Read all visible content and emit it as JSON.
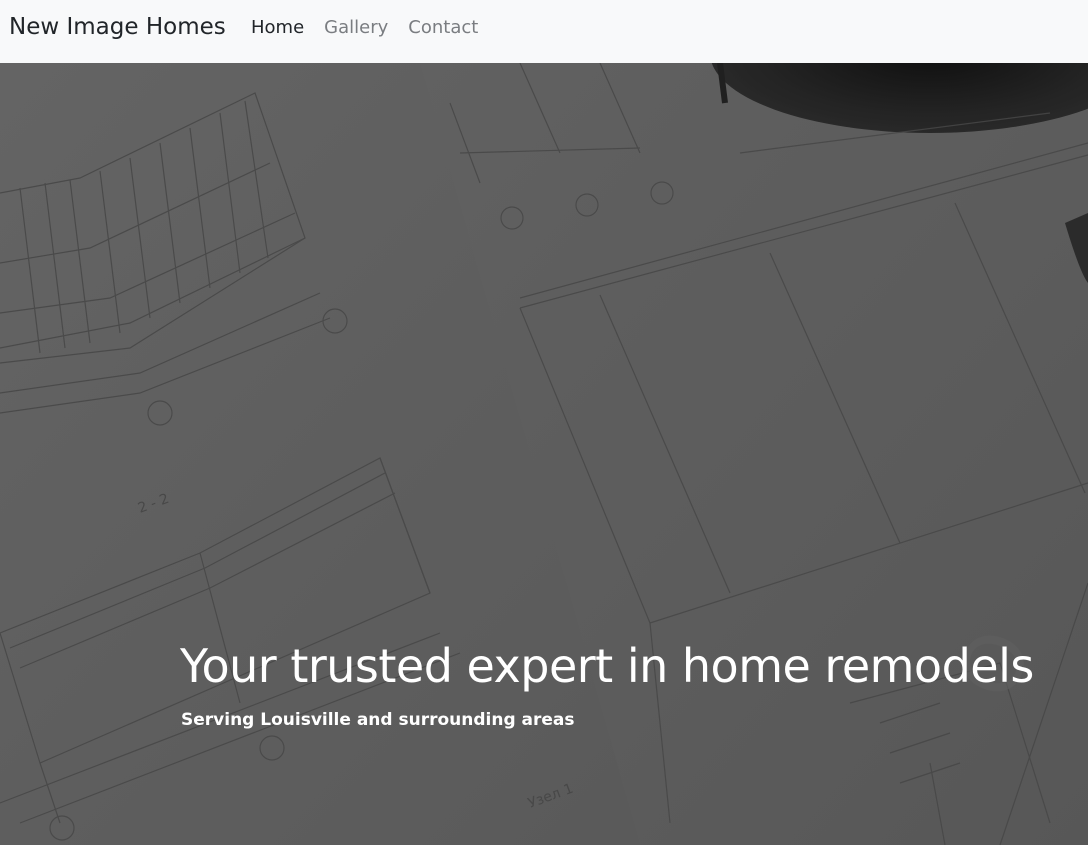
{
  "navbar": {
    "brand": "New Image Homes",
    "links": [
      {
        "label": "Home",
        "active": true
      },
      {
        "label": "Gallery",
        "active": false
      },
      {
        "label": "Contact",
        "active": false
      }
    ]
  },
  "hero": {
    "title": "Your trusted expert in home remodels",
    "subtitle": "Serving Louisville and surrounding areas",
    "background": "blueprint-image"
  },
  "colors": {
    "navbar_bg": "#f8f9fa",
    "brand_text": "#212529",
    "active_link": "#212529",
    "inactive_link": "#7a7d81",
    "hero_overlay": "#5f5f5f",
    "hero_text": "#ffffff"
  }
}
